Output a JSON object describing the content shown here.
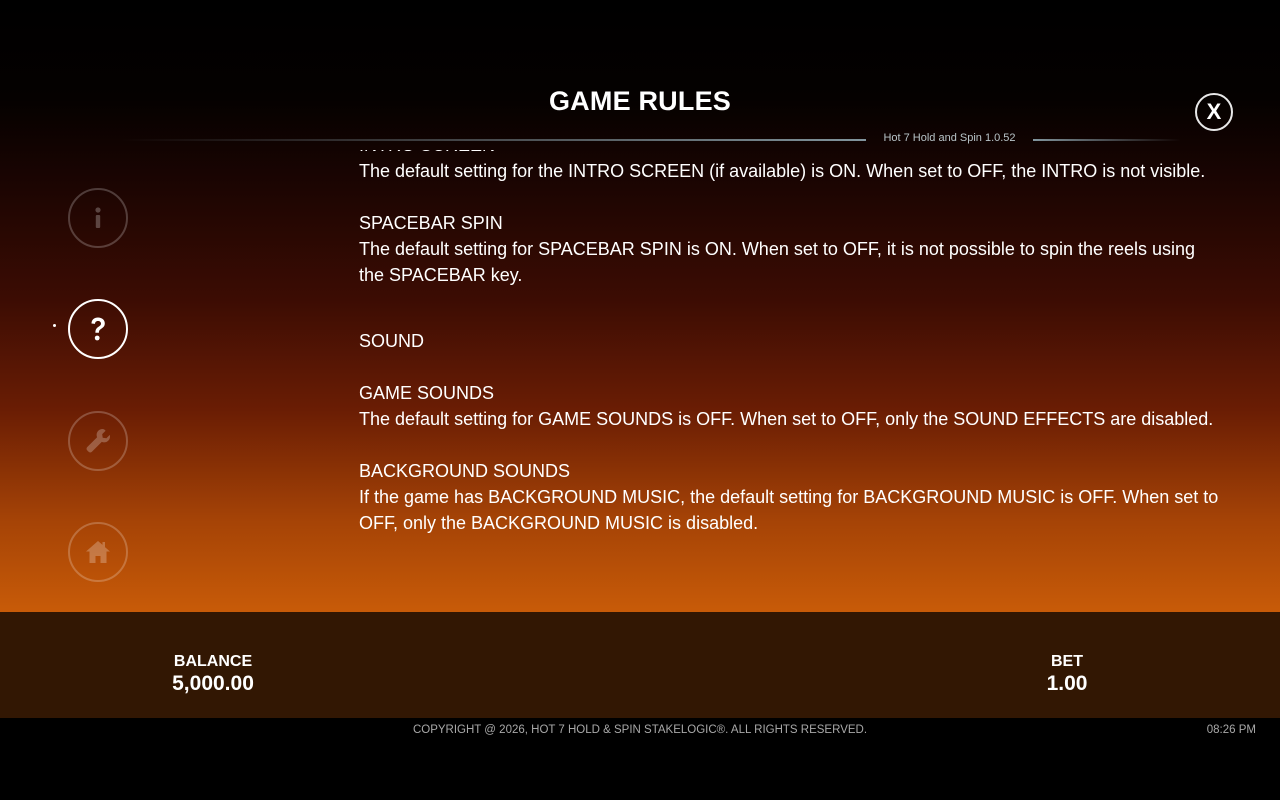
{
  "header": {
    "title": "GAME RULES",
    "version": "Hot 7 Hold and Spin 1.0.52",
    "close_label": "X"
  },
  "sidebar": {
    "items": [
      {
        "name": "info",
        "icon": "info-icon",
        "active": false
      },
      {
        "name": "rules",
        "icon": "question-icon",
        "active": true
      },
      {
        "name": "settings",
        "icon": "wrench-icon",
        "active": false
      },
      {
        "name": "home",
        "icon": "home-icon",
        "active": false
      }
    ]
  },
  "rules": {
    "intro": {
      "heading": "INTRO SCREEN",
      "text": "The default setting for the INTRO SCREEN (if available) is ON. When set to OFF, the INTRO is not visible."
    },
    "spacebar": {
      "heading": "SPACEBAR SPIN",
      "text": "The default setting for SPACEBAR SPIN is ON. When set to OFF, it is not possible to spin the reels using the SPACEBAR key."
    },
    "sound": {
      "heading": "SOUND"
    },
    "game_sounds": {
      "heading": "GAME SOUNDS",
      "text": "The default setting for GAME SOUNDS is OFF. When set to OFF, only the SOUND EFFECTS are disabled."
    },
    "background_sounds": {
      "heading": "BACKGROUND SOUNDS",
      "text": "If the game has BACKGROUND MUSIC, the default setting for BACKGROUND MUSIC is OFF. When set to OFF, only the BACKGROUND MUSIC is disabled."
    }
  },
  "footer": {
    "balance_label": "BALANCE",
    "balance_value": "5,000.00",
    "bet_label": "BET",
    "bet_value": "1.00",
    "copyright": "COPYRIGHT @ 2026, HOT 7 HOLD & SPIN STAKELOGIC®. ALL RIGHTS RESERVED.",
    "time": "08:26 PM"
  },
  "colors": {
    "footer_bg": "#321703",
    "gradient_bottom": "#c85b08",
    "text": "#ffffff"
  }
}
